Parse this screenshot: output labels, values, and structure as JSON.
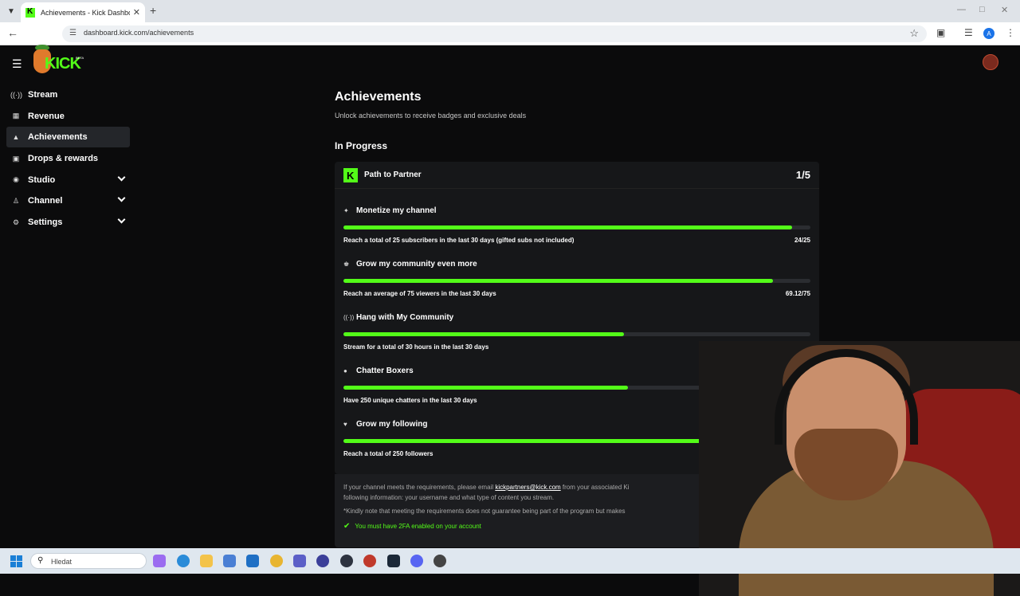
{
  "browser": {
    "tab_title": "Achievements - Kick Dashboard",
    "url": "dashboard.kick.com/achievements",
    "profile_initial": "A"
  },
  "sidebar": {
    "items": [
      {
        "label": "Stream",
        "icon": "broadcast-icon"
      },
      {
        "label": "Revenue",
        "icon": "chart-icon"
      },
      {
        "label": "Achievements",
        "icon": "trophy-icon",
        "active": true
      },
      {
        "label": "Drops & rewards",
        "icon": "gift-icon"
      },
      {
        "label": "Studio",
        "icon": "camera-icon",
        "expandable": true
      },
      {
        "label": "Channel",
        "icon": "users-icon",
        "expandable": true
      },
      {
        "label": "Settings",
        "icon": "gear-icon",
        "expandable": true
      }
    ]
  },
  "main": {
    "title": "Achievements",
    "subtitle": "Unlock achievements to receive badges and exclusive deals",
    "section": "In Progress",
    "card": {
      "title": "Path to Partner",
      "count": "1/5",
      "achievements": [
        {
          "name": "Monetize my channel",
          "requirement": "Reach a total of 25 subscribers in the last 30 days (gifted subs not included)",
          "value": "24/25",
          "progress": 0.96,
          "icon": "sparkle-icon"
        },
        {
          "name": "Grow my community even more",
          "requirement": "Reach an average of 75 viewers in the last 30 days",
          "value": "69.12/75",
          "progress": 0.92,
          "icon": "community-icon"
        },
        {
          "name": "Hang with My Community",
          "requirement": "Stream for a total of 30 hours in the last 30 days",
          "value": "",
          "progress": 0.6,
          "icon": "broadcast-icon"
        },
        {
          "name": "Chatter Boxers",
          "requirement": "Have 250 unique chatters in the last 30 days",
          "value": "",
          "progress": 0.61,
          "icon": "chat-icon"
        },
        {
          "name": "Grow my following",
          "requirement": "Reach a total of 250 followers",
          "value": "",
          "progress": 0.84,
          "icon": "heart-icon"
        }
      ]
    },
    "footer": {
      "note_before": "If your channel meets the requirements, please email ",
      "email": "kickpartners@kick.com",
      "note_after": " from your associated Ki",
      "note_line2": "following information: your username and what type of content you stream.",
      "note2": "*Kindly note that meeting the requirements does not guarantee being part of the program but makes",
      "requirement_2fa": "You must have 2FA enabled on your account"
    }
  },
  "taskbar": {
    "search_placeholder": "Hledat"
  },
  "colors": {
    "accent": "#53fc18",
    "background": "#0b0b0c",
    "card": "#161719"
  }
}
